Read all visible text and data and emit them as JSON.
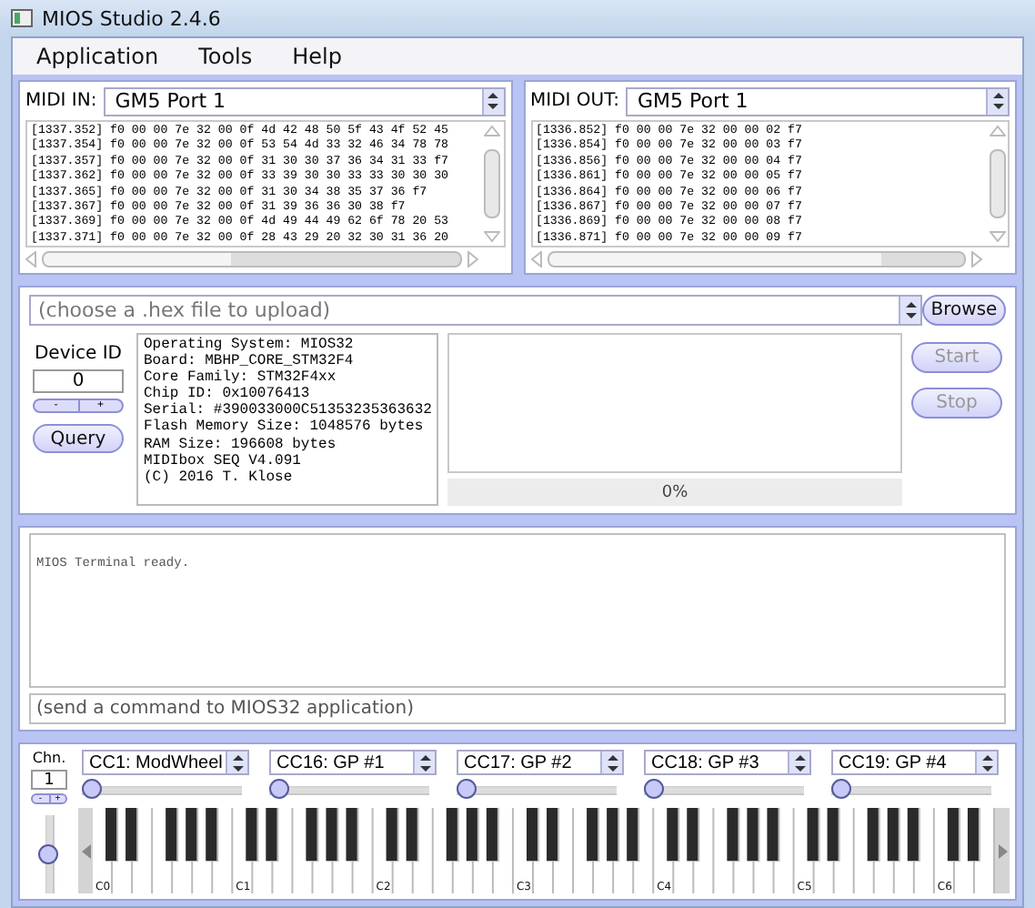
{
  "window": {
    "title": "MIOS Studio 2.4.6"
  },
  "menu": [
    "Application",
    "Tools",
    "Help"
  ],
  "midi_in": {
    "label": "MIDI IN:",
    "port": "GM5 Port 1",
    "log": [
      "[1337.352] f0 00 00 7e 32 00 0f 4d 42 48 50 5f 43 4f 52 45",
      "[1337.354] f0 00 00 7e 32 00 0f 53 54 4d 33 32 46 34 78 78",
      "[1337.357] f0 00 00 7e 32 00 0f 31 30 30 37 36 34 31 33 f7",
      "[1337.362] f0 00 00 7e 32 00 0f 33 39 30 30 33 33 30 30 30",
      "[1337.365] f0 00 00 7e 32 00 0f 31 30 34 38 35 37 36 f7",
      "[1337.367] f0 00 00 7e 32 00 0f 31 39 36 36 30 38 f7",
      "[1337.369] f0 00 00 7e 32 00 0f 4d 49 44 49 62 6f 78 20 53",
      "[1337.371] f0 00 00 7e 32 00 0f 28 43 29 20 32 30 31 36 20"
    ]
  },
  "midi_out": {
    "label": "MIDI OUT:",
    "port": "GM5 Port 1",
    "log": [
      "[1336.852] f0 00 00 7e 32 00 00 02 f7",
      "[1336.854] f0 00 00 7e 32 00 00 03 f7",
      "[1336.856] f0 00 00 7e 32 00 00 04 f7",
      "[1336.861] f0 00 00 7e 32 00 00 05 f7",
      "[1336.864] f0 00 00 7e 32 00 00 06 f7",
      "[1336.867] f0 00 00 7e 32 00 00 07 f7",
      "[1336.869] f0 00 00 7e 32 00 00 08 f7",
      "[1336.871] f0 00 00 7e 32 00 00 09 f7"
    ]
  },
  "upload": {
    "file_placeholder": "(choose a .hex file to upload)",
    "browse": "Browse",
    "device_id_label": "Device ID",
    "device_id": "0",
    "dec": "-",
    "inc": "+",
    "query": "Query",
    "info": [
      "Operating System: MIOS32",
      "Board: MBHP_CORE_STM32F4",
      "Core Family: STM32F4xx",
      "Chip ID: 0x10076413",
      "Serial: #390033000C51353235363632",
      "Flash Memory Size: 1048576 bytes",
      "RAM Size: 196608 bytes",
      "MIDIbox SEQ V4.091",
      "(C) 2016 T. Klose"
    ],
    "progress": {
      "level": 0,
      "reading": "0%"
    },
    "start": {
      "label": "Start",
      "disabled": true
    },
    "stop": {
      "label": "Stop",
      "disabled": true
    }
  },
  "terminal": {
    "output": "MIOS Terminal ready.",
    "placeholder": "(send a command to MIOS32 application)"
  },
  "keyboard": {
    "channel_label": "Chn.",
    "channel": "1",
    "dec": "-",
    "inc": "+",
    "pitch_wheel": {
      "level": 0.5
    },
    "controllers": [
      {
        "label": "CC1: ModWheel",
        "level": 0
      },
      {
        "label": "CC16: GP #1",
        "level": 0
      },
      {
        "label": "CC17: GP #2",
        "level": 0
      },
      {
        "label": "CC18: GP #3",
        "level": 0
      },
      {
        "label": "CC19: GP #4",
        "level": 0
      }
    ],
    "octave_labels": [
      "C0",
      "C1",
      "C2",
      "C3",
      "C4",
      "C5",
      "C6"
    ]
  }
}
